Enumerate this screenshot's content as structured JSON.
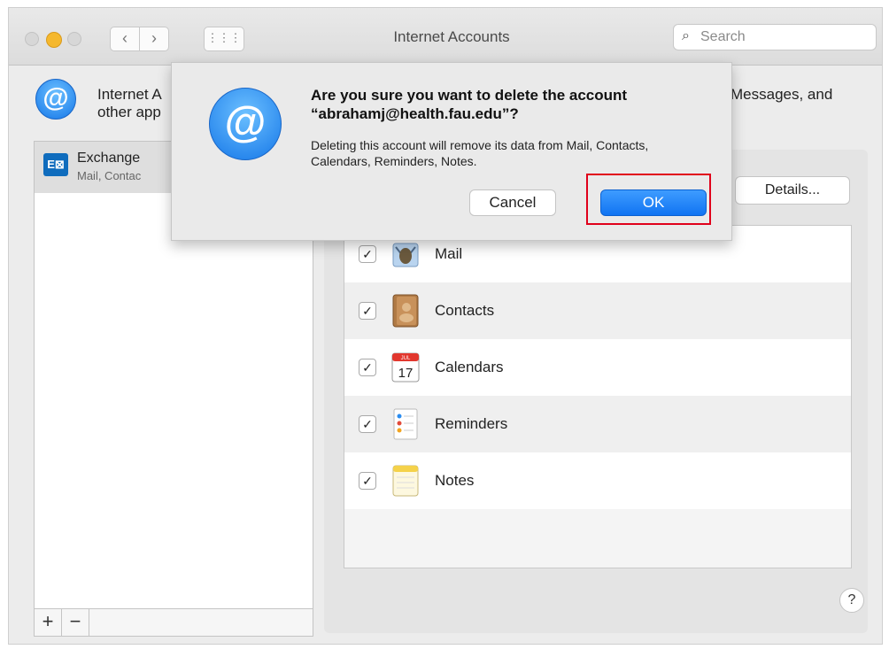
{
  "window": {
    "title": "Internet Accounts",
    "search_placeholder": "Search",
    "back_glyph": "‹",
    "forward_glyph": "›",
    "grid_glyph": "⋮⋮⋮"
  },
  "header": {
    "text_start": "Internet A",
    "text_line2": "other app",
    "text_end": "Messages, and",
    "icon": "at-icon"
  },
  "sidebar": {
    "account": {
      "name": "Exchange",
      "sub": "Mail, Contac",
      "icon": "exchange-icon",
      "icon_text": "E⊠"
    },
    "add_label": "+",
    "remove_label": "−"
  },
  "detail": {
    "details_button": "Details...",
    "help_label": "?",
    "services": [
      {
        "label": "Mail",
        "checked": true,
        "icon": "mail-icon"
      },
      {
        "label": "Contacts",
        "checked": true,
        "icon": "contacts-icon"
      },
      {
        "label": "Calendars",
        "checked": true,
        "icon": "calendar-icon",
        "calendar_month": "JUL",
        "calendar_day": "17"
      },
      {
        "label": "Reminders",
        "checked": true,
        "icon": "reminders-icon"
      },
      {
        "label": "Notes",
        "checked": true,
        "icon": "notes-icon"
      }
    ],
    "check_glyph": "✓"
  },
  "dialog": {
    "title": "Are you sure you want to delete the account “abrahamj@health.fau.edu”?",
    "message": "Deleting this account will remove its data from Mail, Contacts, Calendars, Reminders, Notes.",
    "cancel_label": "Cancel",
    "ok_label": "OK",
    "icon_glyph": "@",
    "highlight_color": "#e0001b"
  }
}
